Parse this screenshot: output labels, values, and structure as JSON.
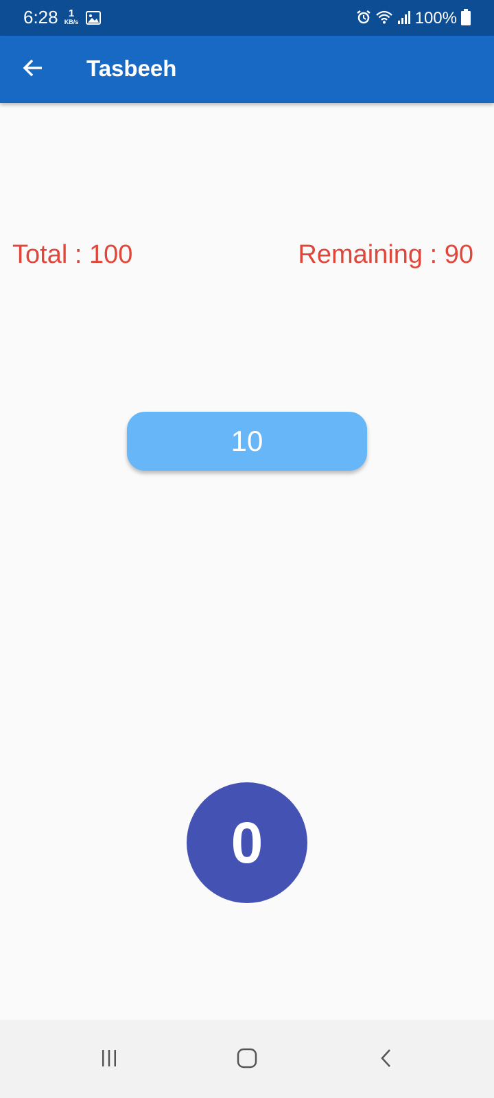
{
  "status_bar": {
    "time": "6:28",
    "net_speed_value": "1",
    "net_speed_unit": "KB/s",
    "battery": "100%",
    "icons": [
      "gallery-icon",
      "alarm-icon",
      "wifi-icon",
      "signal-icon",
      "battery-icon"
    ]
  },
  "app_bar": {
    "title": "Tasbeeh",
    "back_icon": "arrow-back-icon"
  },
  "counter": {
    "total_text": "Total : 100",
    "remaining_text": "Remaining : 90",
    "count_value": "10",
    "tap_button_label": "0"
  },
  "nav_bar": {
    "icons": [
      "recent-apps-icon",
      "home-icon",
      "nav-back-icon"
    ]
  },
  "colors": {
    "status_bar": "#0d4d94",
    "app_bar": "#1769c3",
    "counter_text": "#e0463a",
    "count_pill": "#67b6f7",
    "tap_button": "#4352b3",
    "background": "#fafafa"
  }
}
